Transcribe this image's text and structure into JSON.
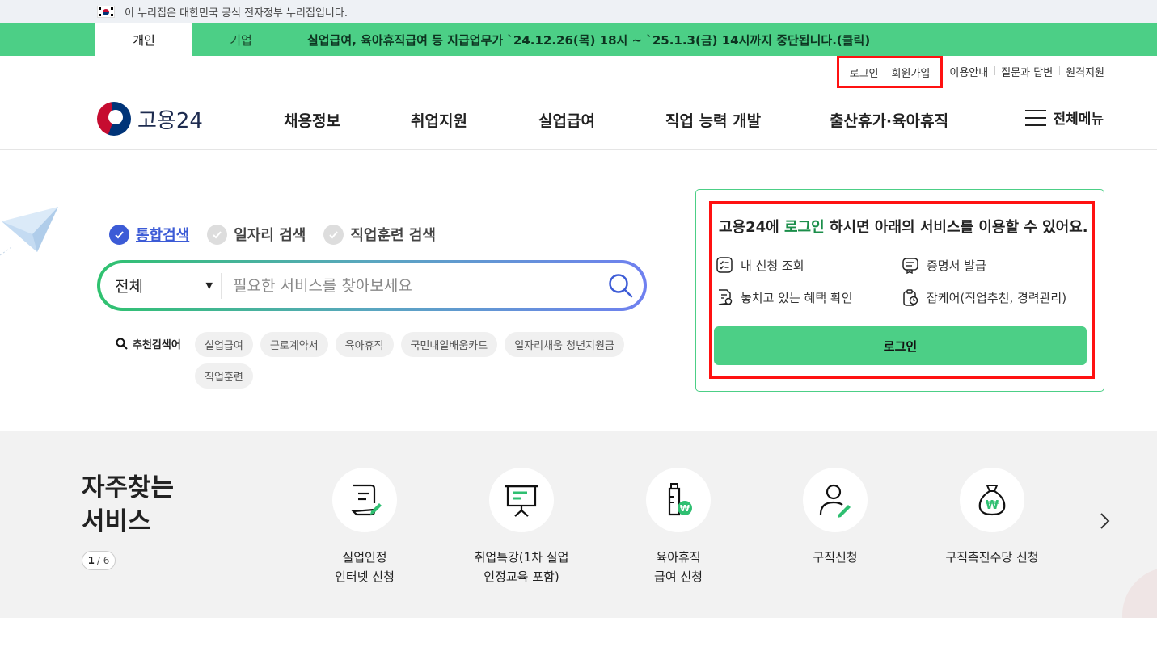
{
  "gov_bar": {
    "text": "이 누리집은 대한민국 공식 전자정부 누리집입니다."
  },
  "tabs": [
    {
      "label": "개인"
    },
    {
      "label": "기업"
    }
  ],
  "notice": "실업급여, 육아휴직급여 등 지급업무가 `24.12.26(목) 18시 ~ `25.1.3(금) 14시까지 중단됩니다.(클릭)",
  "util_links": {
    "login": "로그인",
    "signup": "회원가입",
    "guide": "이용안내",
    "qna": "질문과 답변",
    "remote": "원격지원"
  },
  "logo": {
    "text": "고용24"
  },
  "gnb": [
    {
      "label": "채용정보"
    },
    {
      "label": "취업지원"
    },
    {
      "label": "실업급여"
    },
    {
      "label": "직업 능력 개발"
    },
    {
      "label": "출산휴가·육아휴직"
    }
  ],
  "all_menu": "전체메뉴",
  "search_types": [
    {
      "label": "통합검색",
      "selected": true
    },
    {
      "label": "일자리 검색",
      "selected": false
    },
    {
      "label": "직업훈련 검색",
      "selected": false
    }
  ],
  "search": {
    "category": "전체",
    "placeholder": "필요한 서비스를 찾아보세요"
  },
  "recommend": {
    "title": "추천검색어",
    "chips": [
      "실업급여",
      "근로계약서",
      "육아휴직",
      "국민내일배움카드",
      "일자리채움 청년지원금",
      "직업훈련"
    ]
  },
  "login_card": {
    "title_pre": "고용24에 ",
    "title_highlight": "로그인",
    "title_post": " 하시면 아래의 서비스를 이용할 수 있어요.",
    "services": [
      "내 신청 조회",
      "증명서 발급",
      "놓치고 있는 혜택 확인",
      "잡케어(직업추천, 경력관리)"
    ],
    "button": "로그인"
  },
  "frequent": {
    "title_line1": "자주찾는",
    "title_line2": "서비스",
    "page_current": "1",
    "page_total": "/ 6",
    "items": [
      {
        "line1": "실업인정",
        "line2": "인터넷 신청",
        "icon": "document-pen-icon"
      },
      {
        "line1": "취업특강(1차 실업",
        "line2": "인정교육 포함)",
        "icon": "presentation-board-icon"
      },
      {
        "line1": "육아휴직",
        "line2": "급여 신청",
        "icon": "baby-bottle-icon"
      },
      {
        "line1": "구직신청",
        "line2": "",
        "icon": "person-pen-icon"
      },
      {
        "line1": "구직촉진수당 신청",
        "line2": "",
        "icon": "money-bag-icon"
      }
    ]
  },
  "colors": {
    "brand_green": "#4ccf86",
    "highlight_red": "#ff1111",
    "search_blue": "#3c5bd6"
  }
}
